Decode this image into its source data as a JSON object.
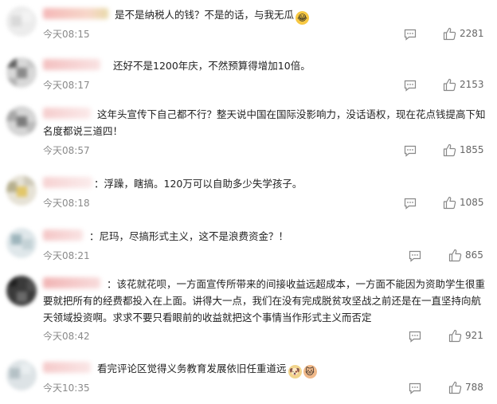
{
  "comments": [
    {
      "username": "",
      "text": "是不是纳税人的钱？不是的话，与我无瓜",
      "emoji": "cry-laugh-emoji",
      "time": "今天08:15",
      "likes": "2281"
    },
    {
      "username": "",
      "text": "还好不是1200年庆，不然预算得增加10倍。",
      "time": "今天08:17",
      "likes": "2153"
    },
    {
      "username": "",
      "text": "这年头宣传下自己都不行？整天说中国在国际没影响力，没话语权，现在花点钱提高下知名度都说三道四！",
      "time": "今天08:57",
      "likes": "1855"
    },
    {
      "username": "",
      "text": "：浮躁，瞎搞。120万可以自助多少失学孩子。",
      "time": "今天08:18",
      "likes": "1085"
    },
    {
      "username": "",
      "text": "：尼玛，尽搞形式主义，这不是浪费资金？！",
      "time": "今天08:21",
      "likes": "865"
    },
    {
      "username": "",
      "text": "：该花就花呗，一方面宣传所带来的间接收益远超成本，一方面不能因为资助学生很重要就把所有的经费都投入在上面。讲得大一点，我们在没有完成脱贫攻坚战之前还是在一直坚持向航天领域投资啊。求求不要只看眼前的收益就把这个事情当作形式主义而否定",
      "time": "今天08:42",
      "likes": "921"
    },
    {
      "username": "",
      "text": "看完评论区觉得义务教育发展依旧任重道远",
      "emoji": "doge-emoji",
      "emoji2": "cat-emoji",
      "time": "今天10:35",
      "likes": "788"
    }
  ],
  "colors": {
    "time": "#8a8a8a",
    "like_count": "#666666",
    "icon": "#888888"
  }
}
